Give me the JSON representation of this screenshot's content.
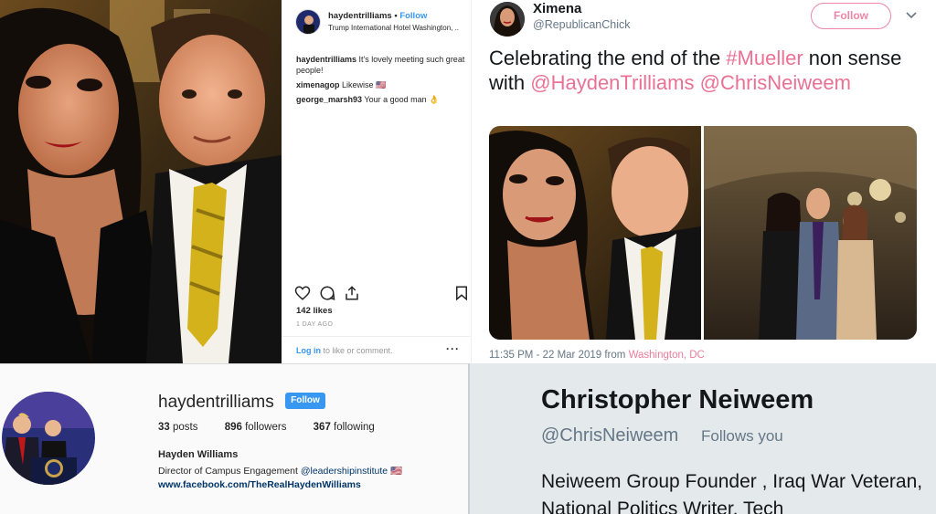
{
  "ig_post": {
    "username": "haydentrilliams",
    "separator": "•",
    "follow_label": "Follow",
    "location": "Trump International Hotel Washington, ..",
    "comments": [
      {
        "user": "haydentrilliams",
        "text": "It's lovely meeting such great people!"
      },
      {
        "user": "ximenagop",
        "text": "Likewise 🇺🇸"
      },
      {
        "user": "george_marsh93",
        "text": "Your a good man 👌"
      }
    ],
    "likes": "142 likes",
    "time": "1 DAY AGO",
    "login_link": "Log in",
    "login_text": " to like or comment.",
    "more": "···",
    "icons": [
      "heart-icon",
      "comment-icon",
      "share-icon",
      "bookmark-icon"
    ]
  },
  "tweet": {
    "name": "Ximena",
    "handle": "@RepublicanChick",
    "follow_label": "Follow",
    "text_parts": {
      "t1": "Celebrating the end of the ",
      "hashtag": "#Mueller",
      "t2": " non sense with ",
      "mention1": "@HaydenTrilliams",
      "t3": " ",
      "mention2": "@ChrisNeiweem"
    },
    "timestamp": "11:35 PM - 22 Mar 2019 from ",
    "location": "Washington, DC",
    "accent_color": "#e0245e"
  },
  "ig_profile": {
    "username": "haydentrilliams",
    "follow_label": "Follow",
    "posts_count": "33",
    "posts_label": " posts",
    "followers_count": "896",
    "followers_label": " followers",
    "following_count": "367",
    "following_label": " following",
    "full_name": "Hayden Williams",
    "bio_text": "Director of Campus Engagement ",
    "bio_mention": "@leadershipinstitute",
    "bio_flag": " 🇺🇸",
    "website": "www.facebook.com/TheRealHaydenWilliams"
  },
  "tw_profile": {
    "name": "Christopher Neiweem",
    "handle": "@ChrisNeiweem",
    "follows_you": "Follows you",
    "bio": "Neiweem Group Founder , Iraq War Veteran, National Politics Writer, Tech"
  }
}
